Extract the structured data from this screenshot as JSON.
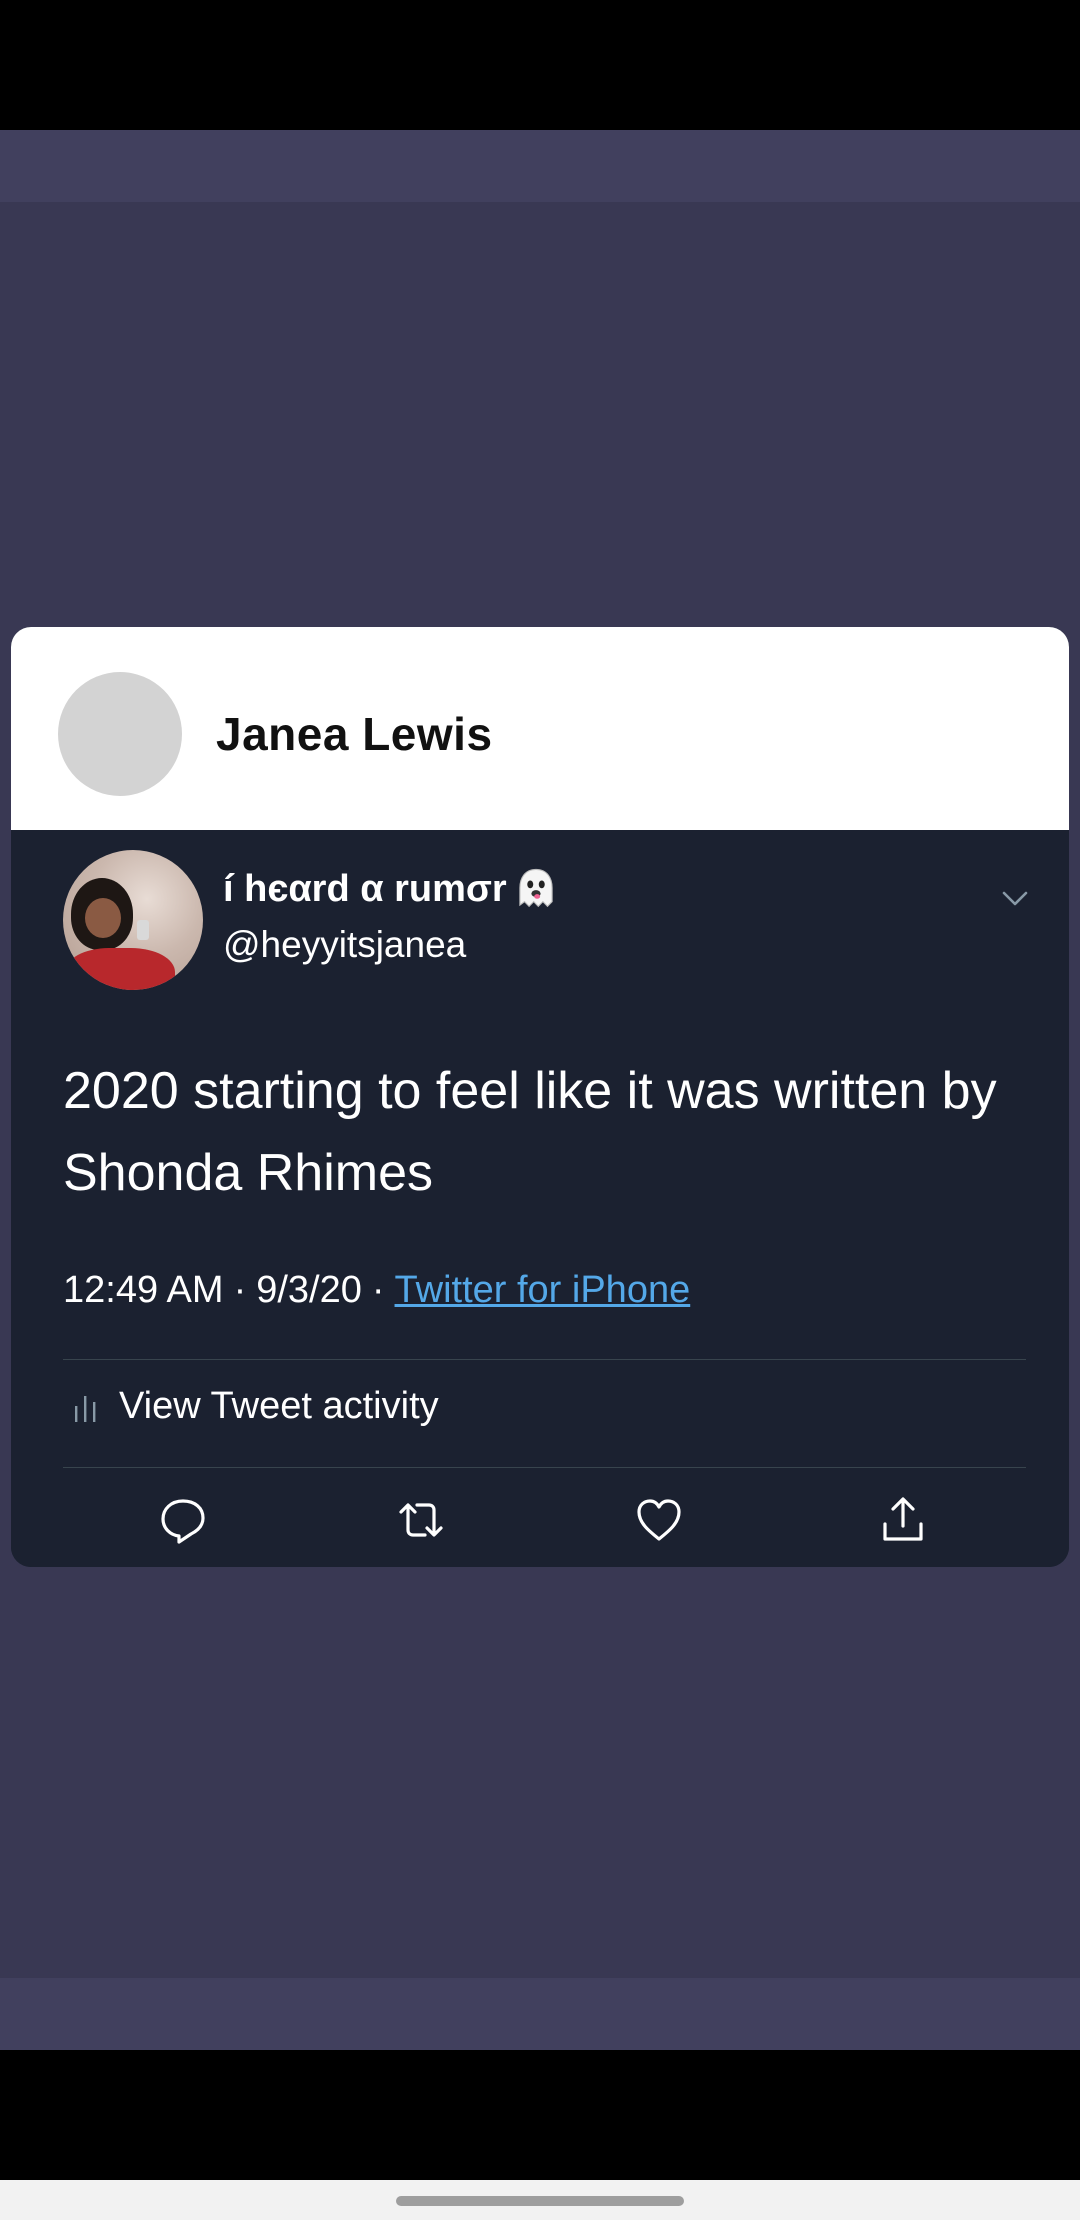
{
  "card": {
    "header_name": "Janea Lewis"
  },
  "tweet": {
    "display_name": "í hєαrd α rumσr",
    "display_name_emoji": "ghost-icon",
    "handle": "@heyyitsjanea",
    "text": "2020 starting to feel like it was written by Shonda Rhimes",
    "time": "12:49 AM",
    "date": "9/3/20",
    "separator": "·",
    "source": "Twitter for iPhone",
    "activity_label": "View Tweet activity"
  },
  "icons": {
    "more": "chevron-down-icon",
    "activity": "bar-chart-icon",
    "reply": "reply-icon",
    "retweet": "retweet-icon",
    "like": "heart-icon",
    "share": "share-icon"
  },
  "colors": {
    "backdrop": "#393853",
    "tweet_bg": "#1b2130",
    "link": "#54a8e8",
    "divider": "#38444d"
  }
}
